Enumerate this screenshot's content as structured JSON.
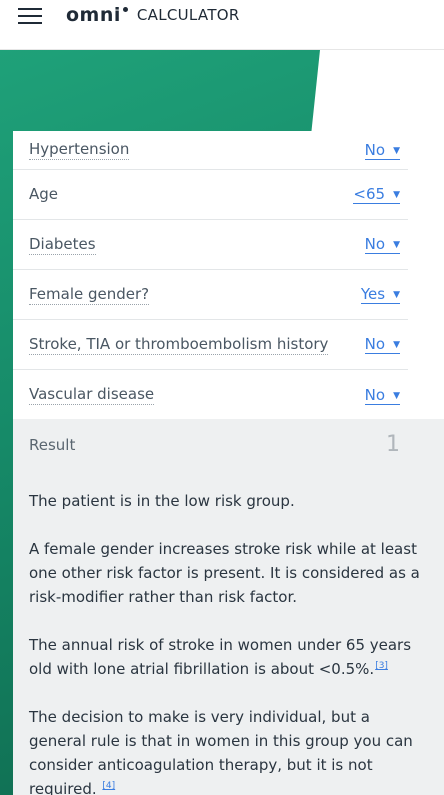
{
  "header": {
    "logo_omni": "omni",
    "logo_calculator": "CALCULATOR"
  },
  "form": {
    "rows": [
      {
        "label": "Hypertension",
        "value": "No"
      },
      {
        "label": "Age",
        "value": "<65"
      },
      {
        "label": "Diabetes",
        "value": "No"
      },
      {
        "label": "Female gender?",
        "value": "Yes"
      },
      {
        "label": "Stroke, TIA or thromboembolism history",
        "value": "No"
      },
      {
        "label": "Vascular disease",
        "value": "No"
      }
    ],
    "arrow_icon": "▼"
  },
  "result": {
    "label": "Result",
    "value": "1",
    "paragraphs": [
      {
        "text": "The patient is in the low risk group.",
        "ref": ""
      },
      {
        "text": "A female gender increases stroke risk while at least one other risk factor is present. It is considered as a risk-modifier rather than risk factor.",
        "ref": ""
      },
      {
        "text": "The annual risk of stroke in women under 65 years old with lone atrial fibrillation is about <0.5%.",
        "ref": "[3]"
      },
      {
        "text": "The decision to make is very individual, but a general rule is that in women in this group you can consider anticoagulation therapy, but it is not required.",
        "ref": "[4]"
      }
    ]
  },
  "colors": {
    "brand_green": "#168a68",
    "link_blue": "#3a7de0"
  }
}
